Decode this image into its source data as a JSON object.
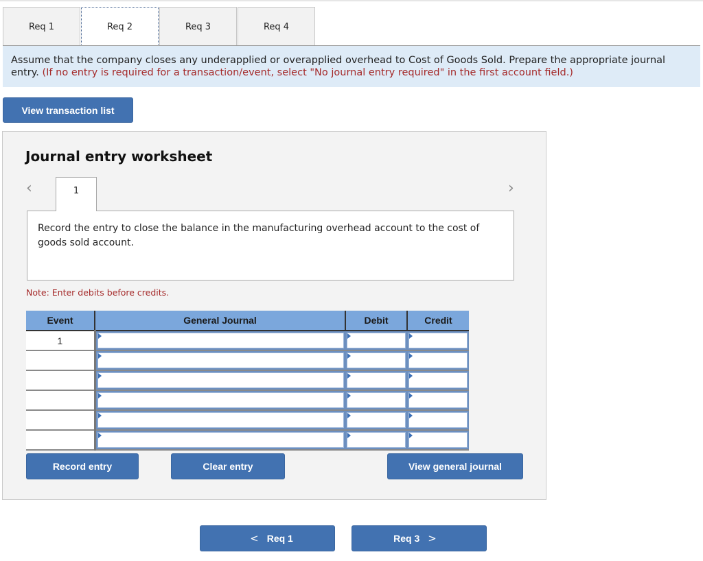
{
  "tabs": [
    {
      "label": "Req 1",
      "active": false
    },
    {
      "label": "Req 2",
      "active": true
    },
    {
      "label": "Req 3",
      "active": false
    },
    {
      "label": "Req 4",
      "active": false
    }
  ],
  "instruction": {
    "main": "Assume that the company closes any underapplied or overapplied overhead to Cost of Goods Sold. Prepare the appropriate journal entry.",
    "note": "(If no entry is required for a transaction/event, select \"No journal entry required\" in the first account field.)"
  },
  "view_transaction_list_label": "View transaction list",
  "worksheet": {
    "title": "Journal entry worksheet",
    "prev_icon": "chevron-left-icon",
    "next_icon": "chevron-right-icon",
    "entry_tab": "1",
    "description": "Record the entry to close the balance in the manufacturing overhead account to the cost of goods sold account.",
    "note": "Note: Enter debits before credits.",
    "table": {
      "headers": [
        "Event",
        "General Journal",
        "Debit",
        "Credit"
      ],
      "rows": [
        {
          "event": "1",
          "account": "",
          "debit": "",
          "credit": ""
        },
        {
          "event": "",
          "account": "",
          "debit": "",
          "credit": ""
        },
        {
          "event": "",
          "account": "",
          "debit": "",
          "credit": ""
        },
        {
          "event": "",
          "account": "",
          "debit": "",
          "credit": ""
        },
        {
          "event": "",
          "account": "",
          "debit": "",
          "credit": ""
        },
        {
          "event": "",
          "account": "",
          "debit": "",
          "credit": ""
        }
      ]
    },
    "record_label": "Record entry",
    "clear_label": "Clear entry",
    "view_gj_label": "View general journal"
  },
  "nav": {
    "prev_label": "Req 1",
    "next_label": "Req 3",
    "prev_glyph": "<",
    "next_glyph": ">"
  },
  "colors": {
    "button_blue": "#4272b1",
    "header_blue": "#7ba7dc",
    "instruction_bg": "#deebf7",
    "note_red": "#a52a2a"
  }
}
